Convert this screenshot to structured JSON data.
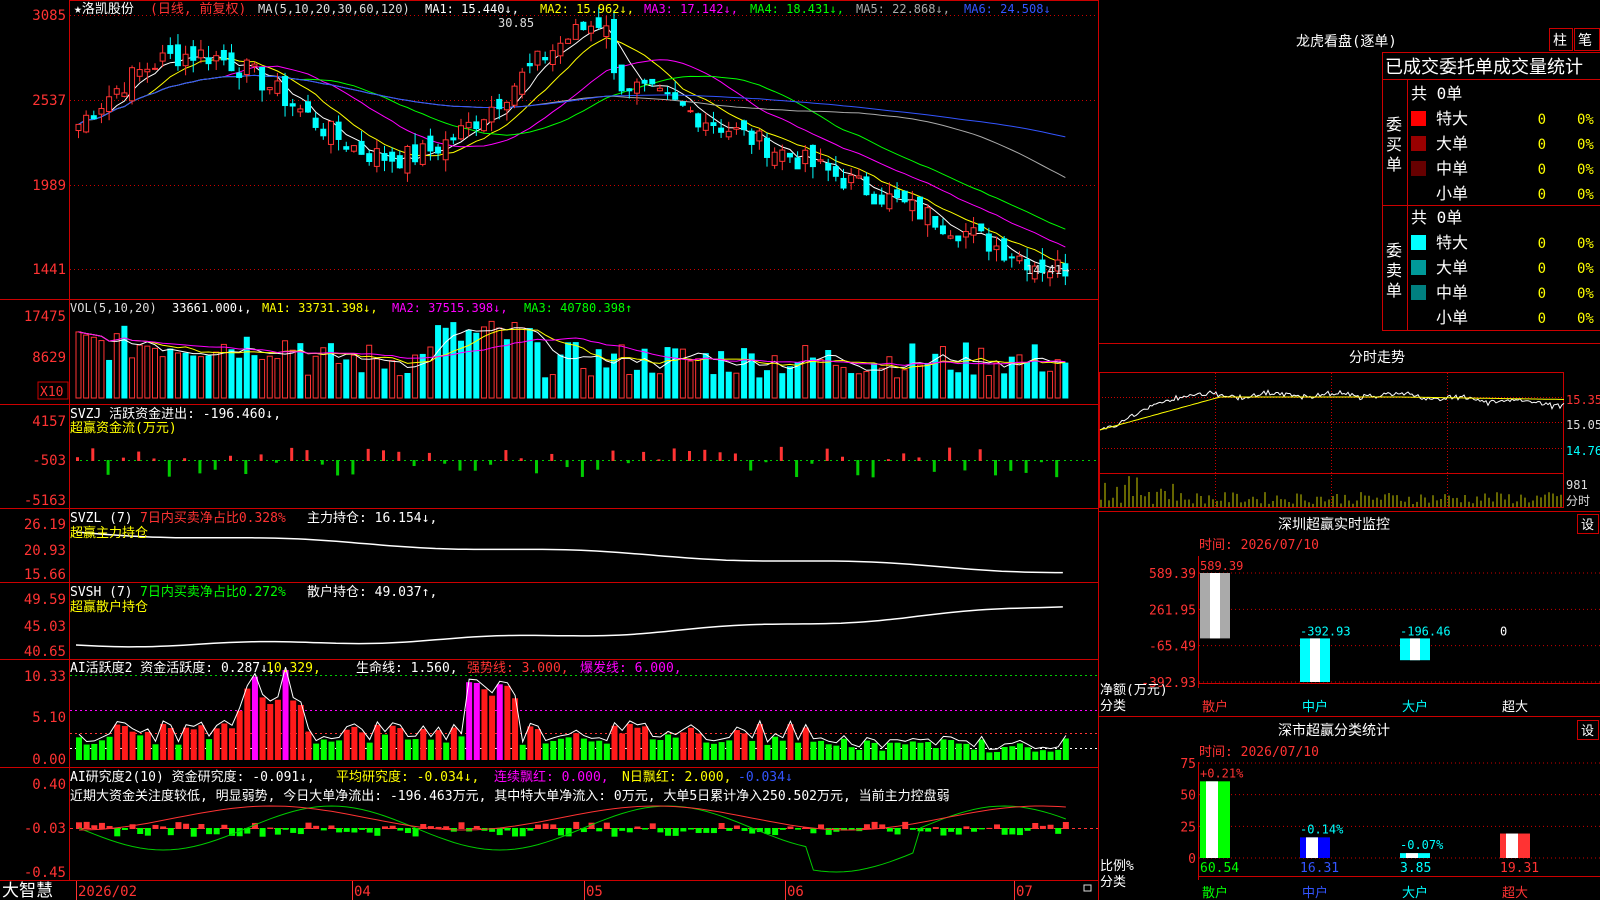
{
  "colors": {
    "up": "#ff3333",
    "down": "#00ffff",
    "grid": "#cc0000",
    "white": "#ffffff",
    "yellow": "#ffff00",
    "magenta": "#ff00ff",
    "green": "#00cc00",
    "blue": "#3355ff",
    "gray": "#aaaaaa",
    "text": "#dddddd"
  },
  "stock": {
    "name": "★洛凯股份",
    "mode": "(日线, 前复权)"
  },
  "price_panel": {
    "ma_head": "MA(5,10,20,30,60,120)",
    "ma": [
      {
        "label": "MA1: 15.440↓,",
        "color": "#ffffff"
      },
      {
        "label": "MA2: 15.962↓,",
        "color": "#ffff00"
      },
      {
        "label": "MA3: 17.142↓,",
        "color": "#ff00ff"
      },
      {
        "label": "MA4: 18.431↓,",
        "color": "#00ff00"
      },
      {
        "label": "MA5: 22.868↓,",
        "color": "#aaaaaa"
      },
      {
        "label": "MA6: 24.508↓",
        "color": "#3355ff"
      }
    ],
    "y_labels": [
      "3085",
      "2537",
      "1989",
      "1441"
    ],
    "high_mark": "30.85",
    "low_mark": "14.41→"
  },
  "vol_panel": {
    "head": "VOL(5,10,20)",
    "labels": [
      {
        "t": "33661.000↓,",
        "c": "#ffffff"
      },
      {
        "t": "MA1: 33731.398↓,",
        "c": "#ffff00"
      },
      {
        "t": "MA2: 37515.398↓,",
        "c": "#ff00ff"
      },
      {
        "t": "MA3: 40780.398↑",
        "c": "#00ff00"
      }
    ],
    "y_labels": [
      "17475",
      "8629"
    ],
    "unit": "X10"
  },
  "svzj_panel": {
    "title": "SVZJ  活跃资金进出: -196.460↓,",
    "subtitle": "超赢资金流(万元)",
    "y_labels": [
      "4157",
      "-503",
      "-5163"
    ]
  },
  "svzl_panel": {
    "title": "SVZL (7)",
    "t2": "7日内买卖净占比0.328%",
    "t3": "主力持仓: 16.154↓,",
    "subtitle": "超赢主力持仓",
    "y_labels": [
      "26.19",
      "20.93",
      "15.66"
    ]
  },
  "svsh_panel": {
    "title": "SVSH (7)",
    "t2": "7日内买卖净占比0.272%",
    "t3": "散户持仓: 49.037↑,",
    "subtitle": "超赢散户持仓",
    "y_labels": [
      "49.59",
      "45.03",
      "40.65"
    ]
  },
  "ai_panel": {
    "labels": [
      {
        "t": "AI活跃度2 资金活跃度: 0.287↓,",
        "c": "#ffffff"
      },
      {
        "t": "10.329,",
        "c": "#ffff00"
      },
      {
        "t": "生命线: 1.560,",
        "c": "#ffffff"
      },
      {
        "t": "强势线: 3.000,",
        "c": "#ff3333"
      },
      {
        "t": "爆发线: 6.000,",
        "c": "#ff00ff"
      }
    ],
    "y_labels": [
      "10.33",
      "5.10",
      "0.00"
    ]
  },
  "research_panel": {
    "labels": [
      {
        "t": "AI研究度2(10) 资金研究度: -0.091↓,",
        "c": "#ffffff"
      },
      {
        "t": "平均研究度: -0.034↓,",
        "c": "#ffff00"
      },
      {
        "t": "连续飘红: 0.000,",
        "c": "#ff00ff"
      },
      {
        "t": "N日飘红: 2.000,",
        "c": "#ffff00"
      },
      {
        "t": "-0.034↓",
        "c": "#3355ff"
      }
    ],
    "comment": "近期大资金关注度较低, 明显弱势, 今日大单净流出: -196.463万元, 其中特大单净流入: 0万元, 大单5日累计净入250.502万元, 当前主力控盘弱",
    "y_labels": [
      "0.40",
      "-0.03",
      "-0.45"
    ]
  },
  "bottom": {
    "brand": "大智慧",
    "dates": [
      "2026/02",
      "04",
      "05",
      "06",
      "07"
    ]
  },
  "lhb": {
    "title": "龙虎看盘(逐单)",
    "tabs": [
      "柱",
      "笔"
    ],
    "header": "已成交委托单成交量统计",
    "buy": {
      "side_label": "委买单",
      "total": "共 0单",
      "rows": [
        {
          "name": "特大",
          "val": "0",
          "pct": "0%",
          "color": "#ff0000"
        },
        {
          "name": "大单",
          "val": "0",
          "pct": "0%",
          "color": "#990000"
        },
        {
          "name": "中单",
          "val": "0",
          "pct": "0%",
          "color": "#660000"
        },
        {
          "name": "小单",
          "val": "0",
          "pct": "0%",
          "color": ""
        }
      ]
    },
    "sell": {
      "side_label": "委卖单",
      "total": "共 0单",
      "rows": [
        {
          "name": "特大",
          "val": "0",
          "pct": "0%",
          "color": "#00ffff"
        },
        {
          "name": "大单",
          "val": "0",
          "pct": "0%",
          "color": "#009999"
        },
        {
          "name": "中单",
          "val": "0",
          "pct": "0%",
          "color": "#008080"
        },
        {
          "name": "小单",
          "val": "0",
          "pct": "0%",
          "color": ""
        }
      ]
    }
  },
  "fenshi": {
    "title": "分时走势",
    "y_labels": [
      "15.35",
      "15.05",
      "14.76"
    ],
    "vol_label": "981",
    "vol_unit": "分时"
  },
  "sz_monitor": {
    "title": "深圳超赢实时监控",
    "setting": "设",
    "time": "时间: 2026/07/10",
    "y_labels": [
      "589.39",
      "261.95",
      "-65.49",
      "-392.93"
    ],
    "unit": "净额(万元)",
    "cat_label": "分类",
    "categories": [
      "散户",
      "中户",
      "大户",
      "超大"
    ],
    "values": [
      589.39,
      -392.93,
      -196.46,
      0
    ],
    "value_labels": [
      "589.39",
      "-392.93",
      "-196.46",
      "0"
    ]
  },
  "sz_class": {
    "title": "深市超赢分类统计",
    "setting": "设",
    "time": "时间: 2026/07/10",
    "y_labels": [
      "75",
      "50",
      "25",
      "0"
    ],
    "unit": "比例%",
    "cat_label": "分类",
    "categories": [
      "散户",
      "中户",
      "大户",
      "超大"
    ],
    "values": [
      60.54,
      16.31,
      3.85,
      19.31
    ],
    "value_labels": [
      "60.54",
      "16.31",
      "3.85",
      "19.31"
    ],
    "change_labels": [
      "+0.21%",
      "-0.14%",
      "-0.07%",
      ""
    ]
  }
}
